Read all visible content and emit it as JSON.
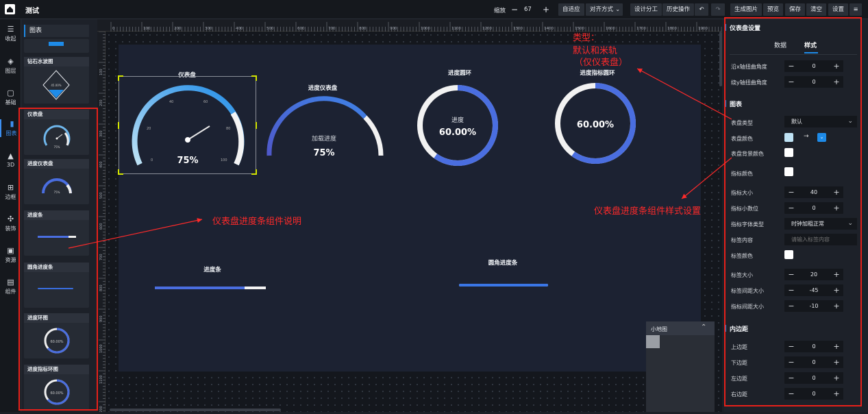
{
  "topbar": {
    "title": "测试",
    "zoom_label": "缩放",
    "zoom_value": "67",
    "minus": "−",
    "plus": "+",
    "buttons": [
      "自适应",
      "对齐方式",
      "设计分工",
      "历史操作",
      "生成图片",
      "预览",
      "保存",
      "清空",
      "设置"
    ],
    "menu": "≡"
  },
  "leftnav": [
    {
      "label": "收起",
      "icon": "collapse-icon"
    },
    {
      "label": "图层",
      "icon": "layers-icon"
    },
    {
      "label": "基础",
      "icon": "basic-icon"
    },
    {
      "label": "图表",
      "icon": "chart-icon"
    },
    {
      "label": "3D",
      "icon": "3d-icon"
    },
    {
      "label": "边框",
      "icon": "border-icon"
    },
    {
      "label": "装饰",
      "icon": "decoration-icon"
    },
    {
      "label": "资源",
      "icon": "image-icon"
    },
    {
      "label": "组件",
      "icon": "component-icon"
    }
  ],
  "panel": {
    "heading": "图表",
    "cards": [
      {
        "title": "钻石水波图",
        "caption": "45.00%"
      },
      {
        "title": "仪表盘",
        "caption": "75%"
      },
      {
        "title": "进度仪表盘",
        "caption": "75%"
      },
      {
        "title": "进度条"
      },
      {
        "title": "圆角进度条"
      },
      {
        "title": "进度环图",
        "caption": "60.00%"
      },
      {
        "title": "进度指标环图",
        "caption": "60.00%"
      }
    ]
  },
  "rulers": {
    "top": [
      "0",
      "100",
      "200",
      "300",
      "400",
      "500",
      "600",
      "700",
      "800",
      "900",
      "1000",
      "1100",
      "1200",
      "1300",
      "1400",
      "1500",
      "1600",
      "1700",
      "1800",
      "1900"
    ],
    "left": [
      "100",
      "200",
      "300",
      "400",
      "500",
      "600",
      "700",
      "800",
      "900",
      "1000",
      "1100",
      "1200"
    ]
  },
  "canvas": {
    "gauge": {
      "title": "仪表盘",
      "value": "75%",
      "ticks": [
        "0",
        "20",
        "40",
        "60",
        "80",
        "100"
      ]
    },
    "progress_gauge": {
      "title": "进度仪表盘",
      "label": "加载进度",
      "value": "75%"
    },
    "ring": {
      "title": "进度圆环",
      "label": "进度",
      "value": "60.00%"
    },
    "indicator_ring": {
      "title": "进度指标圆环",
      "value": "60.00%"
    },
    "bar": {
      "title": "进度条",
      "progress": 0.81
    },
    "round_bar": {
      "title": "圆角进度条",
      "progress": 1.0
    }
  },
  "minimap": {
    "title": "小地图",
    "chevron": "⌃"
  },
  "rpanel": {
    "title": "仪表盘设置",
    "tabs": [
      "数据",
      "样式"
    ],
    "rows_top": [
      {
        "label": "沿x轴扭曲角度",
        "value": "0"
      },
      {
        "label": "绕y轴扭曲角度",
        "value": "0"
      }
    ],
    "section_chart": "图表",
    "chart_type_label": "表盘类型",
    "chart_type_value": "默认",
    "dial_color_label": "表盘颜色",
    "dial_color_from": "#bfe3f5",
    "dial_color_to": "#1e8be8",
    "dial_bg_label": "表盘背景颜色",
    "indicator_color_label": "指标颜色",
    "indicator_size_label": "指标大小",
    "indicator_size": "40",
    "indicator_decimal_label": "指标小数位",
    "indicator_decimal": "0",
    "indicator_font_label": "指标字体类型",
    "indicator_font_value": "时钟加粗正常",
    "tag_content_label": "标签内容",
    "tag_content_placeholder": "请输入标签内容",
    "tag_color_label": "标签颜色",
    "tag_size_label": "标签大小",
    "tag_size": "20",
    "tag_gap_label": "标签间距大小",
    "tag_gap": "-45",
    "indicator_gap_label": "指标间距大小",
    "indicator_gap": "-10",
    "section_padding": "内边距",
    "padding": [
      {
        "label": "上边距",
        "value": "0"
      },
      {
        "label": "下边距",
        "value": "0"
      },
      {
        "label": "左边距",
        "value": "0"
      },
      {
        "label": "右边距",
        "value": "0"
      }
    ]
  },
  "annotations": {
    "type_note": "类型：",
    "type_line2": "默认和米轨",
    "type_line3": "（仅仪表盘）",
    "component_note": "仪表盘进度条组件说明",
    "style_note": "仪表盘进度条组件样式设置"
  },
  "colors": {
    "accent": "#1e8be8",
    "annotation": "#ff2a2a",
    "ring_blue": "#4a6ee0"
  }
}
